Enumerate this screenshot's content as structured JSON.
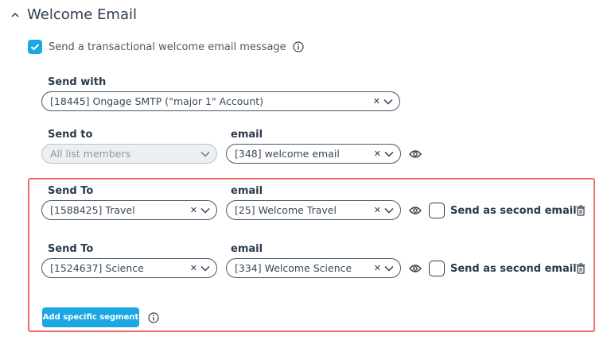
{
  "section": {
    "title": "Welcome Email"
  },
  "send_checkbox": {
    "label": "Send a transactional welcome email message",
    "checked": true
  },
  "send_with": {
    "label": "Send with",
    "value": "[18445] Ongage SMTP (\"major 1\" Account)"
  },
  "default_row": {
    "send_to_label": "Send to",
    "send_to_value": "All list members",
    "email_label": "email",
    "email_value": "[348] welcome email"
  },
  "segments": [
    {
      "send_to_label": "Send To",
      "send_to_value": "[1588425] Travel",
      "email_label": "email",
      "email_value": "[25] Welcome Travel",
      "second_email_label": "Send as second email",
      "second_email_checked": false
    },
    {
      "send_to_label": "Send To",
      "send_to_value": "[1524637] Science",
      "email_label": "email",
      "email_value": "[334] Welcome Science",
      "second_email_label": "Send as second email",
      "second_email_checked": false
    }
  ],
  "add_segment": {
    "label": "Add specific segment"
  },
  "colors": {
    "accent": "#1ba7e3",
    "highlight_border": "#f26b6b",
    "text": "#2b3a4a"
  },
  "icons": [
    "chevron-up-icon",
    "check-icon",
    "info-icon",
    "clear-icon",
    "chevron-down-icon",
    "eye-icon",
    "trash-icon"
  ]
}
